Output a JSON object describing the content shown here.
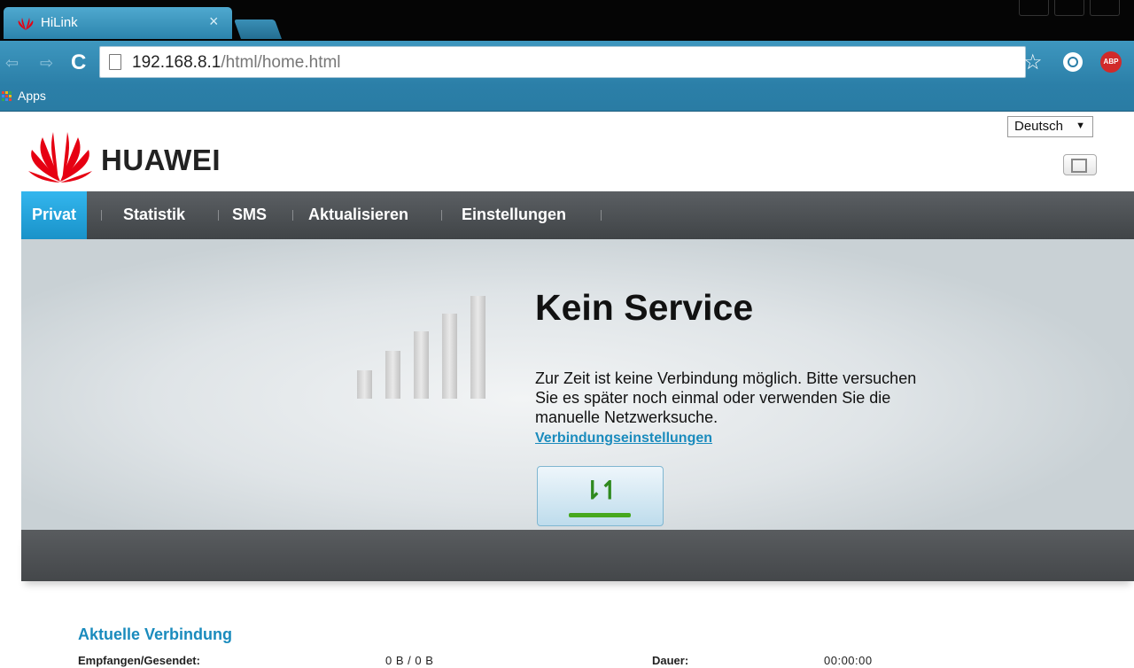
{
  "browser": {
    "tab_title": "HiLink",
    "tab_close": "×",
    "url_host": "192.168.8.1",
    "url_path": "/html/home.html",
    "bookmark_apps": "Apps",
    "abp_label": "ABP",
    "theme_color": "#2b7fa8"
  },
  "header": {
    "language_selected": "Deutsch",
    "logo_text": "HUAWEI"
  },
  "menu": {
    "items": [
      {
        "label": "Privat",
        "active": true
      },
      {
        "label": "Statistik",
        "active": false
      },
      {
        "label": "SMS",
        "active": false
      },
      {
        "label": "Aktualisieren",
        "active": false
      },
      {
        "label": "Einstellungen",
        "active": false
      }
    ],
    "active_color": "#1fa3dd"
  },
  "status": {
    "title": "Kein Service",
    "message": "Zur Zeit ist keine Verbindung möglich. Bitte versuchen Sie es später noch einmal oder verwenden Sie die manuelle Netzwerksuche.",
    "settings_link": "Verbindungseinstellungen",
    "signal_bars_active": 0,
    "signal_bars_total": 5
  },
  "connection": {
    "heading": "Aktuelle Verbindung",
    "received_sent_label": "Empfangen/Gesendet:",
    "received_sent_value": "0 B / 0 B",
    "duration_label": "Dauer:",
    "duration_value": "00:00:00"
  }
}
